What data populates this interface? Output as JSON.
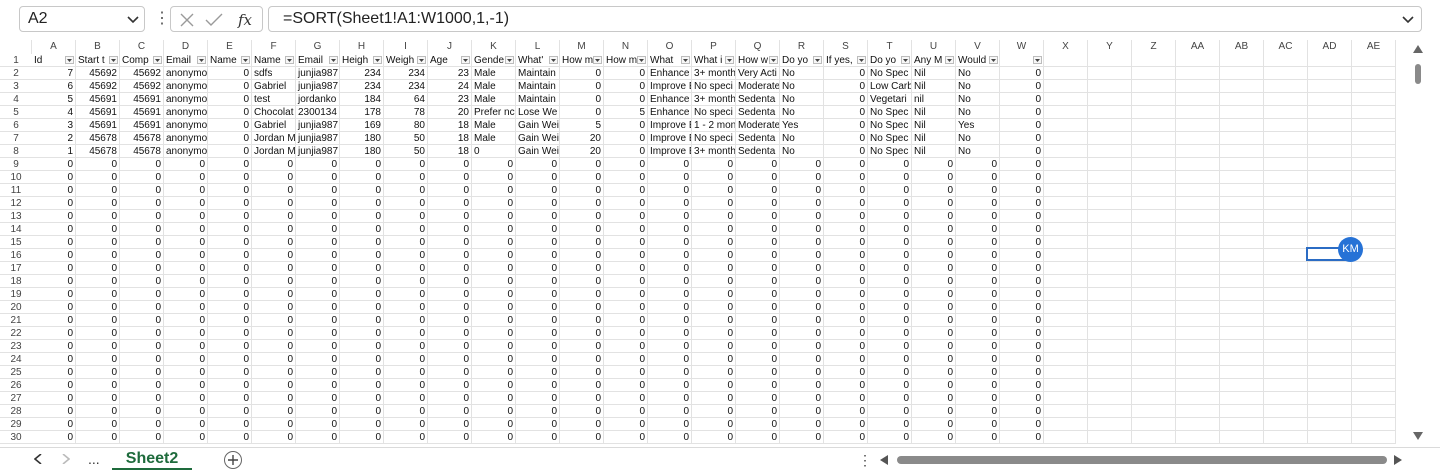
{
  "name_box": {
    "value": "A2"
  },
  "formula_bar": {
    "formula": "=SORT(Sheet1!A1:W1000,1,-1)"
  },
  "column_headers": [
    "A",
    "B",
    "C",
    "D",
    "E",
    "F",
    "G",
    "H",
    "I",
    "J",
    "K",
    "L",
    "M",
    "N",
    "O",
    "P",
    "Q",
    "R",
    "S",
    "T",
    "U",
    "V",
    "W",
    "X",
    "Y",
    "Z",
    "AA",
    "AB",
    "AC",
    "AD",
    "AE"
  ],
  "row_numbers": [
    "1",
    "2",
    "3",
    "4",
    "5",
    "6",
    "7",
    "8",
    "9",
    "10",
    "11",
    "12",
    "13",
    "14",
    "15",
    "16",
    "17",
    "18",
    "19",
    "20",
    "21",
    "22",
    "23",
    "24",
    "25",
    "26",
    "27",
    "28",
    "29",
    "30"
  ],
  "table_headers": [
    "Id",
    "Start t",
    "Comp",
    "Email",
    "Name",
    "Name",
    "Email",
    "Heigh",
    "Weigh",
    "Age",
    "Gende",
    "What'",
    "How m",
    "How m",
    "What",
    "What i",
    "How w",
    "Do yo",
    "If yes,",
    "Do yo",
    "Any M",
    "Would",
    ""
  ],
  "data_rows": [
    [
      "7",
      "45692",
      "45692",
      "anonymo",
      "0",
      "sdfs",
      "junjia987",
      "234",
      "234",
      "23",
      "Male",
      "Maintain",
      "0",
      "0",
      "Enhance",
      "3+ month",
      "Very Acti",
      "No",
      "0",
      "No Spec",
      "Nil",
      "No",
      "0"
    ],
    [
      "6",
      "45692",
      "45692",
      "anonymo",
      "0",
      "Gabriel",
      "junjia987",
      "234",
      "234",
      "24",
      "Male",
      "Maintain",
      "0",
      "0",
      "Improve E",
      "No speci",
      "Moderate",
      "No",
      "0",
      "Low Carb",
      "Nil",
      "No",
      "0"
    ],
    [
      "5",
      "45691",
      "45691",
      "anonymo",
      "0",
      "test",
      "jordanko",
      "184",
      "64",
      "23",
      "Male",
      "Maintain",
      "0",
      "0",
      "Enhance",
      "3+ month",
      "Sedenta",
      "No",
      "0",
      "Vegetari",
      "nil",
      "No",
      "0"
    ],
    [
      "4",
      "45691",
      "45691",
      "anonymo",
      "0",
      "Chocolat",
      "2300134",
      "178",
      "78",
      "20",
      "Prefer nc",
      "Lose We",
      "0",
      "5",
      "Enhance",
      "No speci",
      "Sedenta",
      "No",
      "0",
      "No Spec",
      "Nil",
      "No",
      "0"
    ],
    [
      "3",
      "45691",
      "45691",
      "anonymo",
      "0",
      "Gabriel",
      "junjia987",
      "169",
      "80",
      "18",
      "Male",
      "Gain Wei",
      "5",
      "0",
      "Improve E",
      "1 - 2 mon",
      "Moderate",
      "Yes",
      "0",
      "No Spec",
      "Nil",
      "Yes",
      "0"
    ],
    [
      "2",
      "45678",
      "45678",
      "anonymo",
      "0",
      "Jordan M",
      "junjia987",
      "180",
      "50",
      "18",
      "Male",
      "Gain Wei",
      "20",
      "0",
      "Improve E",
      "No speci",
      "Sedenta",
      "No",
      "0",
      "No Spec",
      "Nil",
      "No",
      "0"
    ],
    [
      "1",
      "45678",
      "45678",
      "anonymo",
      "0",
      "Jordan M",
      "junjia987",
      "180",
      "50",
      "18",
      "0",
      "Gain Wei",
      "20",
      "0",
      "Improve E",
      "3+ month",
      "Sedenta",
      "No",
      "0",
      "No Spec",
      "Nil",
      "No",
      "0"
    ]
  ],
  "zero_fill_value": "0",
  "presence": {
    "user_initials": "KM",
    "color": "#2672d6"
  },
  "sheet_tabs": [
    {
      "label": "Sheet2",
      "active": true
    }
  ],
  "tab_nav": {
    "more": "..."
  },
  "colors": {
    "accent": "#1e6b3c",
    "selection": "#2b6cc4"
  }
}
